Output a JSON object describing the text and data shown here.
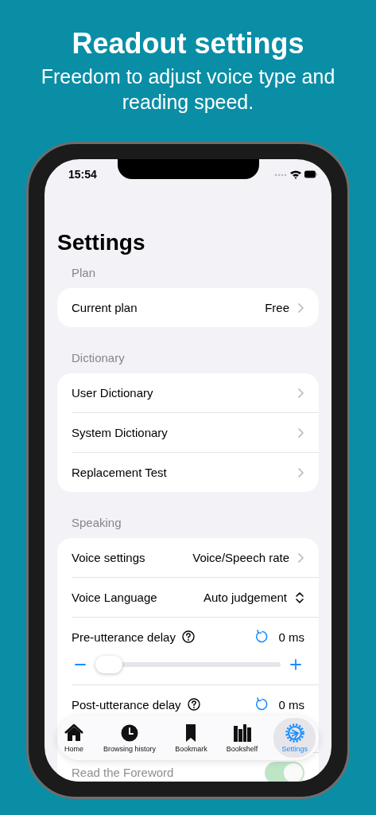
{
  "header": {
    "title": "Readout settings",
    "subtitle": "Freedom to adjust voice type and reading speed."
  },
  "status_bar": {
    "time": "15:54"
  },
  "page_title": "Settings",
  "sections": [
    {
      "header": "Plan",
      "rows": [
        {
          "kind": "link",
          "label": "Current plan",
          "value": "Free"
        }
      ]
    },
    {
      "header": "Dictionary",
      "rows": [
        {
          "kind": "link",
          "label": "User Dictionary"
        },
        {
          "kind": "link",
          "label": "System Dictionary"
        },
        {
          "kind": "link",
          "label": "Replacement Test"
        }
      ]
    },
    {
      "header": "Speaking",
      "rows": [
        {
          "kind": "link",
          "label": "Voice settings",
          "value": "Voice/Speech rate"
        },
        {
          "kind": "picker",
          "label": "Voice Language",
          "value": "Auto judgement"
        },
        {
          "kind": "slider",
          "label": "Pre-utterance delay",
          "value": "0 ms",
          "level": 0
        },
        {
          "kind": "slider",
          "label": "Post-utterance delay",
          "value": "0 ms"
        },
        {
          "kind": "toggle",
          "label": "Read the Foreword",
          "on": true
        }
      ]
    }
  ],
  "tab_bar": [
    {
      "label": "Home",
      "selected": false
    },
    {
      "label": "Browsing history",
      "selected": false
    },
    {
      "label": "Bookmark",
      "selected": false
    },
    {
      "label": "Bookshelf",
      "selected": false
    },
    {
      "label": "Settings",
      "selected": true
    }
  ]
}
